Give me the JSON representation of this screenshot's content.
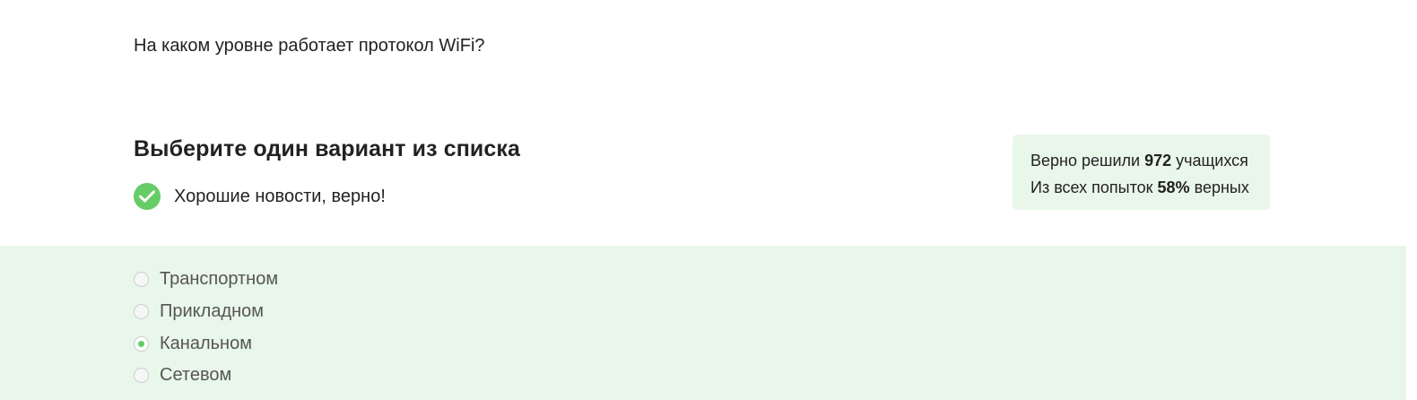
{
  "question": {
    "text": "На каком уровне работает протокол WiFi?"
  },
  "task": {
    "heading": "Выберите один вариант из списка"
  },
  "feedback": {
    "icon": "check-circle-icon",
    "text": "Хорошие новости, верно!",
    "color": "#66cc66"
  },
  "stats": {
    "line1_prefix": "Верно решили ",
    "line1_count": "972",
    "line1_suffix": " учащихся",
    "line2_prefix": "Из всех попыток ",
    "line2_percent": "58%",
    "line2_suffix": " верных",
    "background": "#e9f6ea"
  },
  "options": [
    {
      "label": "Транспортном",
      "selected": false
    },
    {
      "label": "Прикладном",
      "selected": false
    },
    {
      "label": "Канальном",
      "selected": true
    },
    {
      "label": "Сетевом",
      "selected": false
    }
  ],
  "colors": {
    "accent": "#66cc66",
    "panel_bg": "#e9f6ea"
  }
}
